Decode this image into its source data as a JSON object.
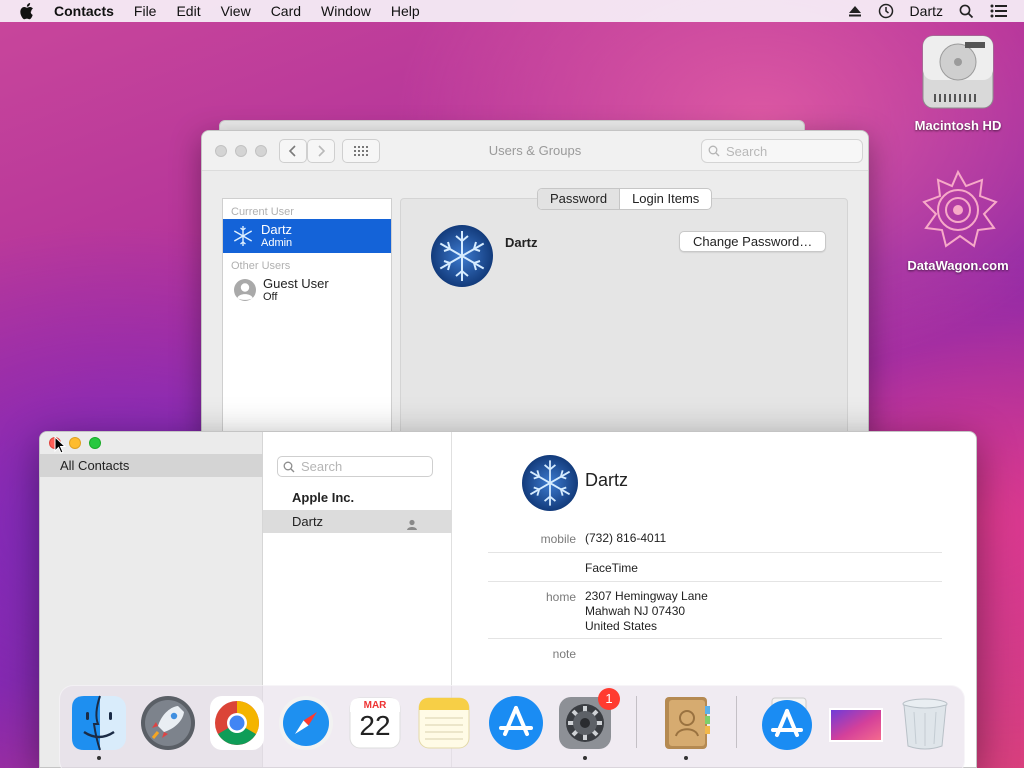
{
  "menubar": {
    "app_name": "Contacts",
    "items": [
      "File",
      "Edit",
      "View",
      "Card",
      "Window",
      "Help"
    ],
    "user": "Dartz"
  },
  "desktop": {
    "icons": [
      {
        "label": "Macintosh HD",
        "icon": "hard-drive-icon"
      },
      {
        "label": "DataWagon.com",
        "icon": "datawagon-logo-icon"
      }
    ]
  },
  "users_groups": {
    "title": "Users & Groups",
    "search_placeholder": "Search",
    "sections": {
      "current": "Current User",
      "other": "Other Users"
    },
    "current_user": {
      "name": "Dartz",
      "role": "Admin"
    },
    "other_user": {
      "name": "Guest User",
      "status": "Off"
    },
    "tabs": [
      "Password",
      "Login Items"
    ],
    "selected_tab": "Password",
    "account_name": "Dartz",
    "change_password_label": "Change Password…"
  },
  "contacts": {
    "group": "All Contacts",
    "search_placeholder": "Search",
    "list": {
      "company": "Apple Inc.",
      "selected": "Dartz"
    },
    "card": {
      "name": "Dartz",
      "fields": [
        {
          "label": "mobile",
          "value": "(732) 816-4011"
        },
        {
          "label": "",
          "value": "FaceTime"
        },
        {
          "label": "home",
          "lines": [
            "2307 Hemingway Lane",
            "Mahwah NJ 07430",
            "United States"
          ]
        },
        {
          "label": "note",
          "value": ""
        }
      ]
    }
  },
  "dock": {
    "apps": [
      "Finder",
      "Launchpad",
      "Chrome",
      "Safari",
      "Calendar",
      "Notes",
      "App Store",
      "System Preferences",
      "Contacts",
      "App Store Downloads",
      "Desktop Folder",
      "Trash"
    ],
    "calendar": {
      "month": "MAR",
      "day": "22"
    },
    "system_prefs_badge": "1"
  },
  "colors": {
    "selection_blue": "#1463d8",
    "badge_red": "#ff3b30"
  }
}
